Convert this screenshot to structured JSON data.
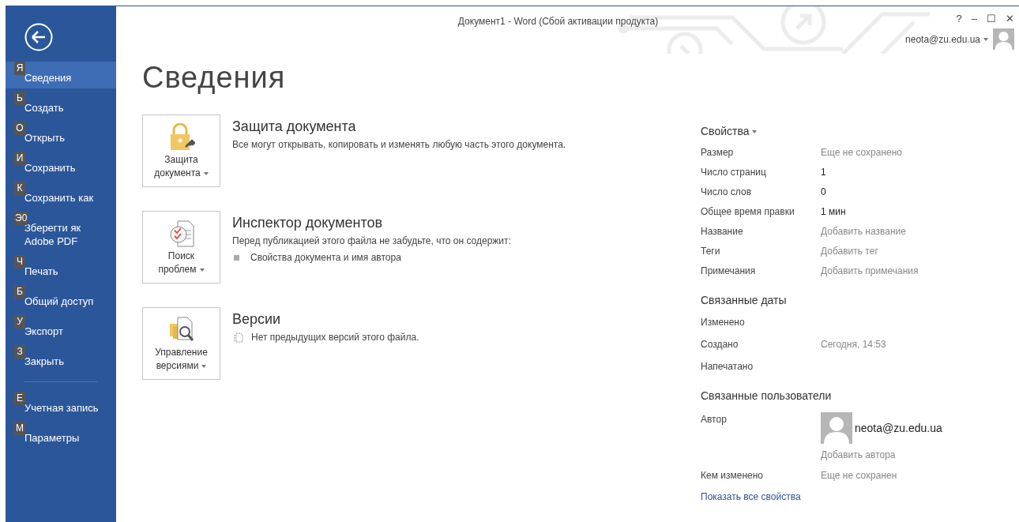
{
  "window": {
    "title": "Документ1 - Word (Сбой активации продукта)",
    "controls": [
      "?",
      "–",
      "☐",
      "✕"
    ],
    "account": "neota@zu.edu.ua"
  },
  "sidebar": {
    "items": [
      {
        "label": "Сведения",
        "key": "Я",
        "selected": true
      },
      {
        "label": "Создать",
        "key": "Ь",
        "selected": false
      },
      {
        "label": "Открыть",
        "key": "О",
        "selected": false
      },
      {
        "label": "Сохранить",
        "key": "И",
        "selected": false
      },
      {
        "label": "Сохранить как",
        "key": "К",
        "selected": false
      },
      {
        "label": "Зберегти як Adobe PDF",
        "key": "Э0",
        "selected": false
      },
      {
        "label": "Печать",
        "key": "Ч",
        "selected": false
      },
      {
        "label": "Общий доступ",
        "key": "Б",
        "selected": false
      },
      {
        "label": "Экспорт",
        "key": "У",
        "selected": false
      },
      {
        "label": "Закрыть",
        "key": "З",
        "selected": false
      }
    ],
    "bottom_items": [
      {
        "label": "Учетная запись",
        "key": "Е",
        "selected": false
      },
      {
        "label": "Параметры",
        "key": "М",
        "selected": false
      }
    ]
  },
  "page_title": "Сведения",
  "sections": [
    {
      "kind": "protect",
      "button": [
        "Защита",
        "документа"
      ],
      "title": "Защита документа",
      "text": "Все могут открывать, копировать и изменять любую часть этого документа."
    },
    {
      "kind": "inspect",
      "button": [
        "Поиск",
        "проблем"
      ],
      "title": "Инспектор документов",
      "text": "Перед публикацией этого файла не забудьте, что он содержит:",
      "bullets": [
        "Свойства документа и имя автора"
      ]
    },
    {
      "kind": "versions",
      "button": [
        "Управление",
        "версиями"
      ],
      "title": "Версии",
      "note": "Нет предыдущих версий этого файла."
    }
  ],
  "properties": {
    "title": "Свойства",
    "rows": [
      {
        "label": "Размер",
        "value": "Еще не сохранено",
        "kind": "placeholder"
      },
      {
        "label": "Число страниц",
        "value": "1",
        "kind": "value"
      },
      {
        "label": "Число слов",
        "value": "0",
        "kind": "value"
      },
      {
        "label": "Общее время правки",
        "value": "1 мин",
        "kind": "value"
      },
      {
        "label": "Название",
        "value": "Добавить название",
        "kind": "placeholder"
      },
      {
        "label": "Теги",
        "value": "Добавить тег",
        "kind": "placeholder"
      },
      {
        "label": "Примечания",
        "value": "Добавить примечания",
        "kind": "placeholder"
      }
    ]
  },
  "dates": {
    "title": "Связанные даты",
    "rows": [
      {
        "label": "Изменено"
      },
      {
        "label": "Создано",
        "value": "Сегодня, 14:53"
      },
      {
        "label": "Напечатано"
      }
    ]
  },
  "people": {
    "title": "Связанные пользователи",
    "author_label": "Автор",
    "author": "neota@zu.edu.ua",
    "add_author": "Добавить автора",
    "modified_label": "Кем изменено",
    "modified_value": "Еще не сохранен",
    "show_all": "Показать все свойства"
  }
}
